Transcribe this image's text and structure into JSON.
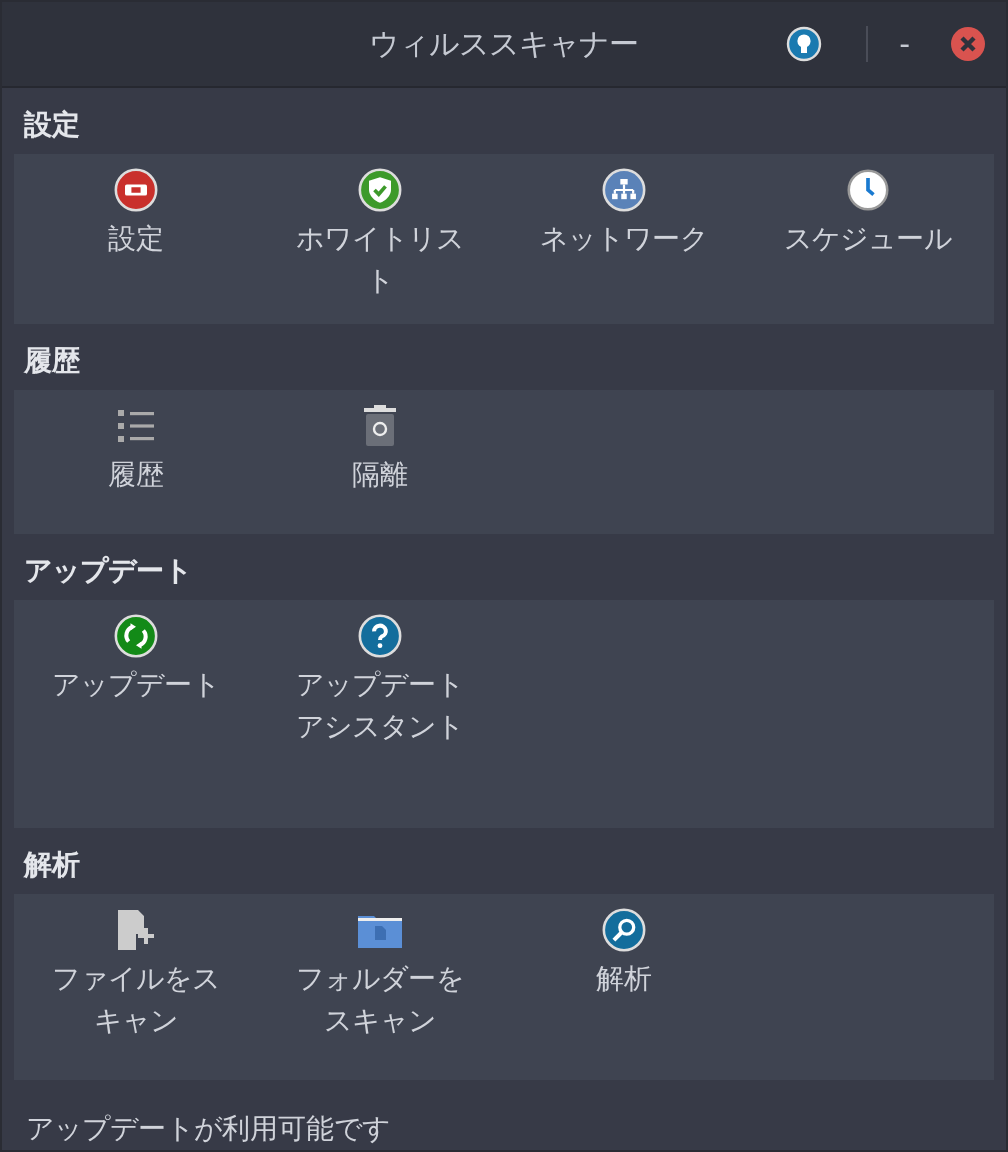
{
  "window": {
    "title": "ウィルススキャナー",
    "minimize": "-"
  },
  "sections": [
    {
      "title": "設定",
      "items": [
        {
          "kind": "settings",
          "label": [
            "設定"
          ]
        },
        {
          "kind": "whitelist",
          "label": [
            "ホワイトリス",
            "ト"
          ]
        },
        {
          "kind": "network",
          "label": [
            "ネットワーク"
          ]
        },
        {
          "kind": "schedule",
          "label": [
            "スケジュール"
          ]
        }
      ]
    },
    {
      "title": "履歴",
      "items": [
        {
          "kind": "history",
          "label": [
            "履歴"
          ]
        },
        {
          "kind": "quarantine",
          "label": [
            "隔離"
          ]
        }
      ]
    },
    {
      "title": "アップデート",
      "items": [
        {
          "kind": "update",
          "label": [
            "アップデート"
          ]
        },
        {
          "kind": "help",
          "label": [
            "アップデート",
            "アシスタント"
          ]
        }
      ]
    },
    {
      "title": "解析",
      "items": [
        {
          "kind": "file",
          "label": [
            "ファイルをス",
            "キャン"
          ]
        },
        {
          "kind": "folder",
          "label": [
            "フォルダーを",
            "スキャン"
          ]
        },
        {
          "kind": "analyze",
          "label": [
            "解析"
          ]
        }
      ]
    }
  ],
  "status_bar": "アップデートが利用可能です"
}
